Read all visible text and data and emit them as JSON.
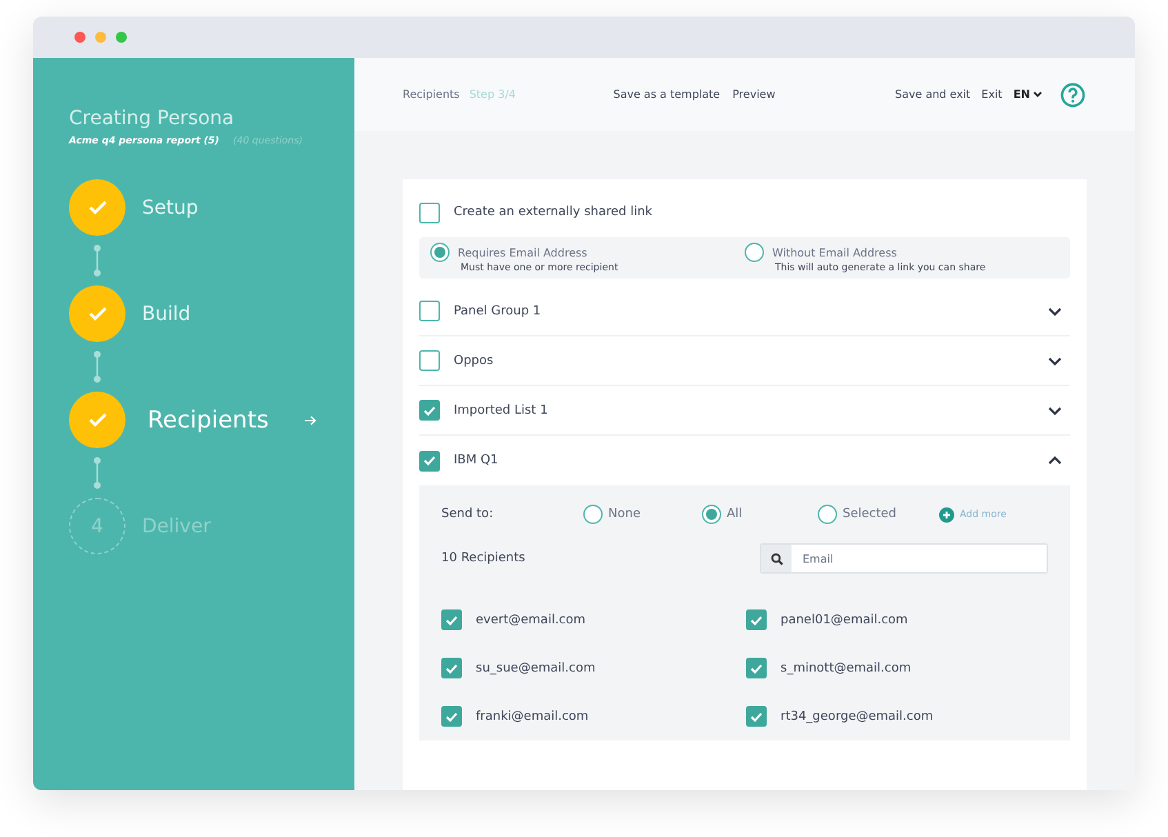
{
  "sidebar": {
    "title": "Creating Persona",
    "subtitle": "Acme q4 persona report (5)",
    "meta": "(40 questions)",
    "steps": [
      {
        "label": "Setup",
        "done": true,
        "current": false
      },
      {
        "label": "Build",
        "done": true,
        "current": false
      },
      {
        "label": "Recipients",
        "done": true,
        "current": true
      },
      {
        "label": "Deliver",
        "number": "4",
        "done": false,
        "current": false
      }
    ]
  },
  "header": {
    "breadcrumb": "Recipients",
    "step": "Step 3/4",
    "center_links": [
      "Save as a template",
      "Preview"
    ],
    "right_links": [
      "Save and exit",
      "Exit"
    ],
    "language": "EN"
  },
  "shared_link": {
    "label": "Create an externally shared link",
    "checked": false,
    "options": [
      {
        "title": "Requires Email Address",
        "subtitle": "Must have one or more recipient",
        "selected": true
      },
      {
        "title": "Without Email Address",
        "subtitle": "This will auto generate a link you can share",
        "selected": false
      }
    ]
  },
  "groups": [
    {
      "name": "Panel Group 1",
      "checked": false,
      "expanded": false
    },
    {
      "name": "Oppos",
      "checked": false,
      "expanded": false
    },
    {
      "name": "Imported List 1",
      "checked": true,
      "expanded": false
    },
    {
      "name": "IBM Q1",
      "checked": true,
      "expanded": true,
      "detail": {
        "send_to_label": "Send to:",
        "send_options": [
          {
            "label": "None",
            "selected": false
          },
          {
            "label": "All",
            "selected": true
          },
          {
            "label": "Selected",
            "selected": false
          }
        ],
        "add_more": "Add more",
        "count": "10 Recipients",
        "search_placeholder": "Email",
        "recipients": [
          {
            "email": "evert@email.com",
            "checked": true
          },
          {
            "email": "panel01@email.com",
            "checked": true
          },
          {
            "email": "su_sue@email.com",
            "checked": true
          },
          {
            "email": "s_minott@email.com",
            "checked": true
          },
          {
            "email": "franki@email.com",
            "checked": true
          },
          {
            "email": "rt34_george@email.com",
            "checked": true
          }
        ]
      }
    }
  ]
}
